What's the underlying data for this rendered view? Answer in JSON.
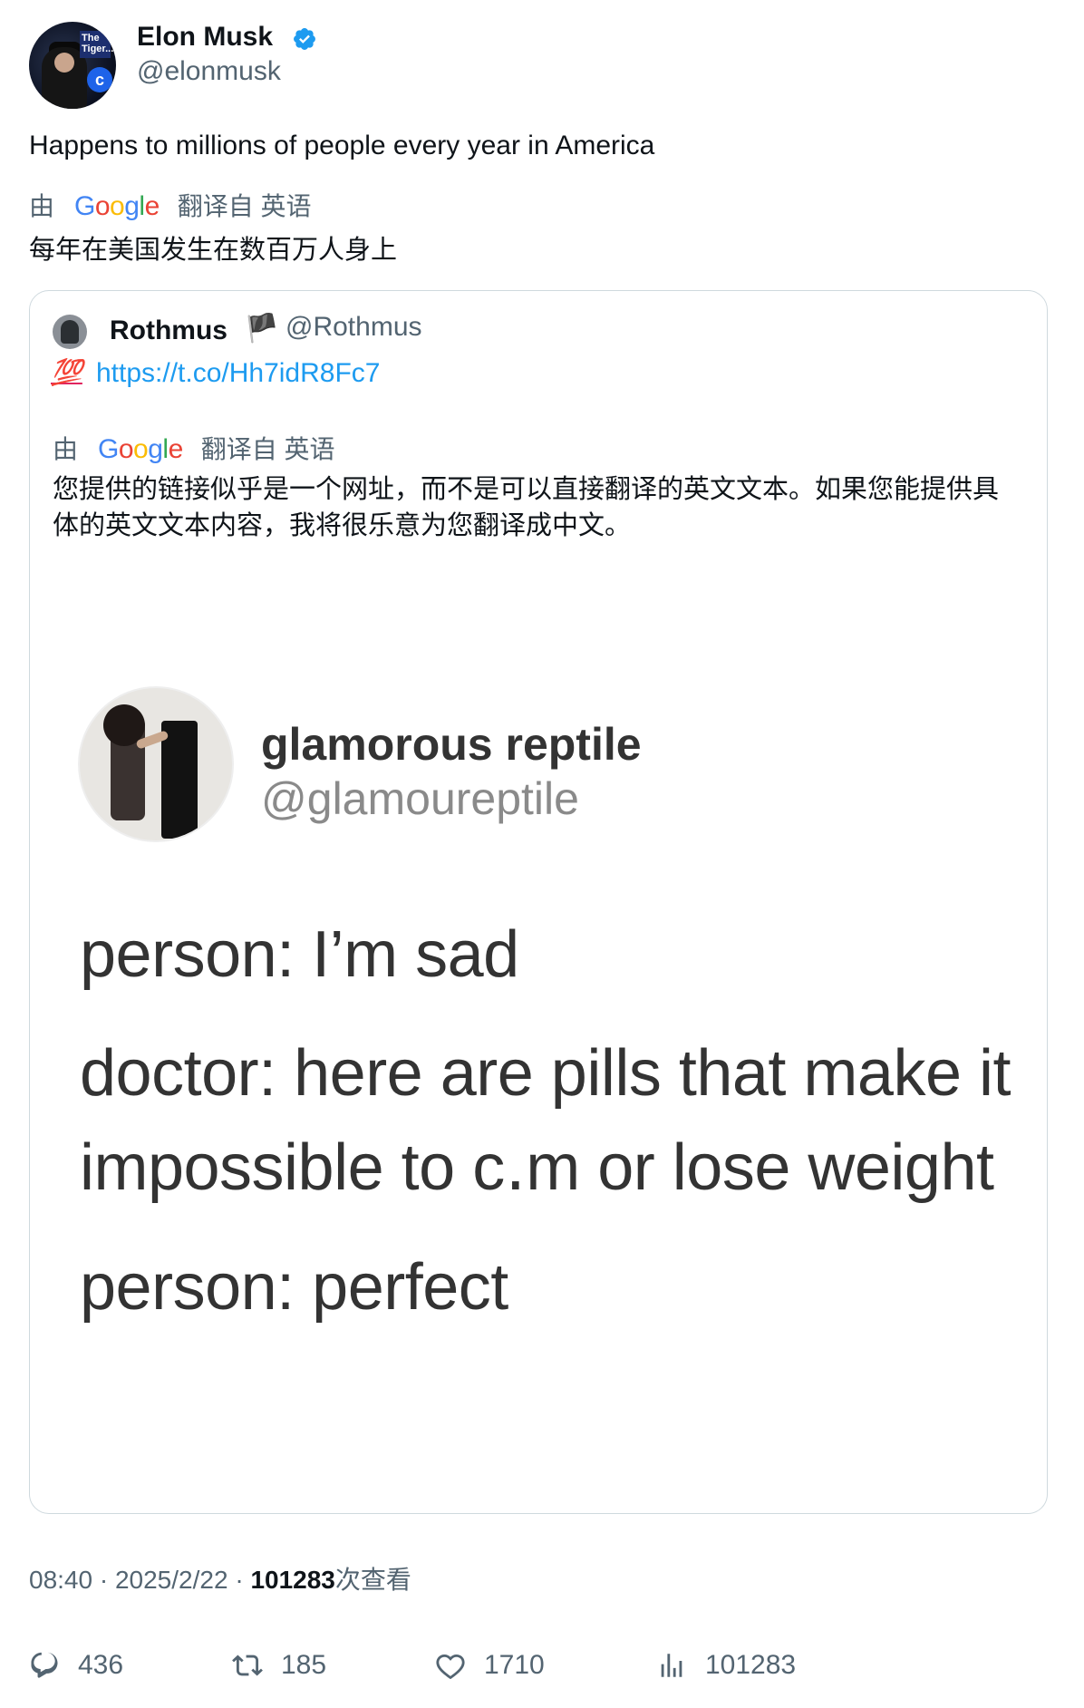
{
  "author": {
    "name": "Elon Musk",
    "handle": "@elonmusk",
    "verified": true,
    "avatar_tag": "The Tiger...",
    "avatar_badge": "c"
  },
  "tweet": {
    "text": "Happens to millions of people every year in America",
    "translate_prefix": "由",
    "translate_brand": "Google",
    "translate_suffix": "翻译自 英语",
    "translated_text": "每年在美国发生在数百万人身上"
  },
  "quoted": {
    "name": "Rothmus",
    "flag": "🏴",
    "handle": "@Rothmus",
    "emoji": "💯",
    "link": "https://t.co/Hh7idR8Fc7",
    "translate_prefix": "由",
    "translate_brand": "Google",
    "translate_suffix": "翻译自 英语",
    "translated_text": "您提供的链接似乎是一个网址，而不是可以直接翻译的英文文本。如果您能提供具体的英文文本内容，我将很乐意为您翻译成中文。"
  },
  "embedded_image": {
    "name": "glamorous reptile",
    "handle": "@glamoureptile",
    "lines": [
      "person: I’m sad",
      "doctor: here are pills that make it",
      "impossible to c․m or lose weight",
      "person: perfect"
    ]
  },
  "meta": {
    "time": "08:40",
    "date": "2025/2/22",
    "separator": "·",
    "views_count": "101283",
    "views_label": "次查看"
  },
  "actions": {
    "replies": "436",
    "retweets": "185",
    "likes": "1710",
    "views": "101283"
  },
  "colors": {
    "link": "#1d9bf0",
    "secondary": "#536471",
    "verified": "#1d9bf0",
    "border": "#cfd9de"
  }
}
